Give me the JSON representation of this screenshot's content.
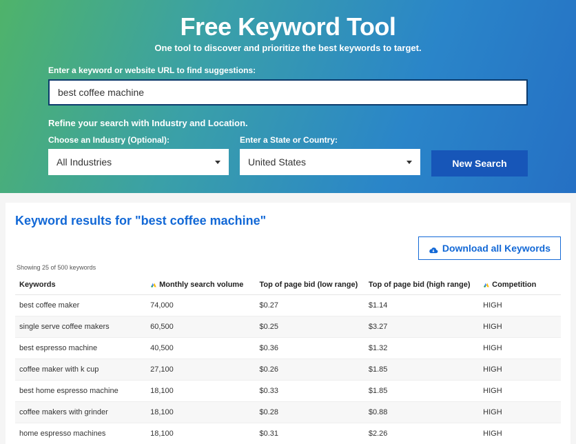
{
  "hero": {
    "title": "Free Keyword Tool",
    "subtitle": "One tool to discover and prioritize the best keywords to target.",
    "input_label": "Enter a keyword or website URL to find suggestions:",
    "input_value": "best coffee machine",
    "refine_label": "Refine your search with Industry and Location.",
    "industry_label": "Choose an Industry (Optional):",
    "industry_value": "All Industries",
    "location_label": "Enter a State or Country:",
    "location_value": "United States",
    "search_btn": "New Search"
  },
  "results": {
    "title": "Keyword results for \"best coffee machine\"",
    "download_btn": "Download all Keywords",
    "showing_text": "Showing 25 of 500 keywords",
    "columns": {
      "keywords": "Keywords",
      "volume": "Monthly search volume",
      "bid_low": "Top of page bid (low range)",
      "bid_high": "Top of page bid (high range)",
      "competition": "Competition"
    },
    "rows": [
      {
        "kw": "best coffee maker",
        "vol": "74,000",
        "low": "$0.27",
        "high": "$1.14",
        "comp": "HIGH"
      },
      {
        "kw": "single serve coffee makers",
        "vol": "60,500",
        "low": "$0.25",
        "high": "$3.27",
        "comp": "HIGH"
      },
      {
        "kw": "best espresso machine",
        "vol": "40,500",
        "low": "$0.36",
        "high": "$1.32",
        "comp": "HIGH"
      },
      {
        "kw": "coffee maker with k cup",
        "vol": "27,100",
        "low": "$0.26",
        "high": "$1.85",
        "comp": "HIGH"
      },
      {
        "kw": "best home espresso machine",
        "vol": "18,100",
        "low": "$0.33",
        "high": "$1.85",
        "comp": "HIGH"
      },
      {
        "kw": "coffee makers with grinder",
        "vol": "18,100",
        "low": "$0.28",
        "high": "$0.88",
        "comp": "HIGH"
      },
      {
        "kw": "home espresso machines",
        "vol": "18,100",
        "low": "$0.31",
        "high": "$2.26",
        "comp": "HIGH"
      }
    ]
  },
  "colors": {
    "accent": "#1268d6",
    "button": "#1756b8"
  }
}
